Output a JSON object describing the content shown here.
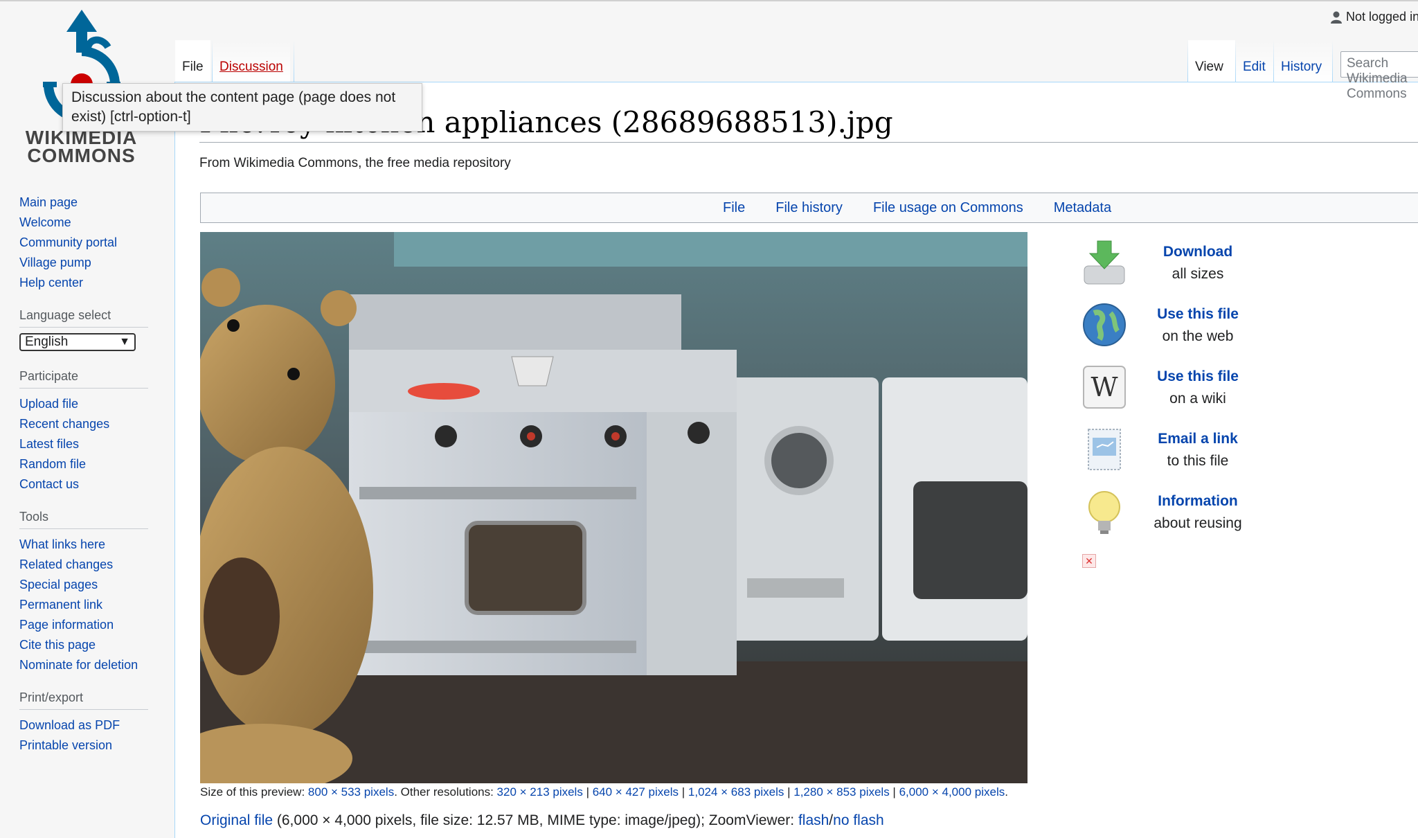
{
  "header": {
    "user_status": "Not logged in",
    "search_placeholder": "Search Wikimedia Commons",
    "tabs_left": [
      {
        "label": "File",
        "selected": true,
        "exists": true
      },
      {
        "label": "Discussion",
        "selected": false,
        "exists": false
      }
    ],
    "tabs_right": [
      {
        "label": "View",
        "selected": true
      },
      {
        "label": "Edit",
        "selected": false
      },
      {
        "label": "History",
        "selected": false
      }
    ]
  },
  "logo": {
    "line1": "WIKIMEDIA",
    "line2": "COMMONS"
  },
  "tooltip": "Discussion about the content page (page does not exist) [ctrl-option-t]",
  "page": {
    "title": "File:Toy kitchen appliances (28689688513).jpg",
    "site_sub": "From Wikimedia Commons, the free media repository"
  },
  "sidebar": {
    "navigation": [
      "Main page",
      "Welcome",
      "Community portal",
      "Village pump",
      "Help center"
    ],
    "language": {
      "heading": "Language select",
      "selected": "English"
    },
    "participate": {
      "heading": "Participate",
      "items": [
        "Upload file",
        "Recent changes",
        "Latest files",
        "Random file",
        "Contact us"
      ]
    },
    "tools": {
      "heading": "Tools",
      "items": [
        "What links here",
        "Related changes",
        "Special pages",
        "Permanent link",
        "Page information",
        "Cite this page",
        "Nominate for deletion"
      ]
    },
    "print": {
      "heading": "Print/export",
      "items": [
        "Download as PDF",
        "Printable version"
      ]
    }
  },
  "filetoc": [
    "File",
    "File history",
    "File usage on Commons",
    "Metadata"
  ],
  "side_tools": [
    {
      "icon": "download-icon",
      "title": "Download",
      "sub": "all sizes"
    },
    {
      "icon": "globe-icon",
      "title": "Use this file",
      "sub": "on the web"
    },
    {
      "icon": "wikipedia-icon",
      "title": "Use this file",
      "sub": "on a wiki"
    },
    {
      "icon": "email-icon",
      "title": "Email a link",
      "sub": "to this file"
    },
    {
      "icon": "lightbulb-icon",
      "title": "Information",
      "sub": "about reusing"
    }
  ],
  "size_info": {
    "prefix": "Size of this preview: ",
    "preview": "800 × 533 pixels",
    "middle": ". Other resolutions: ",
    "resolutions": [
      "320 × 213 pixels",
      "640 × 427 pixels",
      "1,024 × 683 pixels",
      "1,280 × 853 pixels",
      "6,000 × 4,000 pixels"
    ],
    "sep": " | ",
    "suffix": "."
  },
  "original": {
    "link": "Original file",
    "details": " (6,000 × 4,000 pixels, file size: 12.57 MB, MIME type: image/jpeg); ZoomViewer: ",
    "flash": "flash",
    "slash": "/",
    "noflash": "no flash"
  }
}
